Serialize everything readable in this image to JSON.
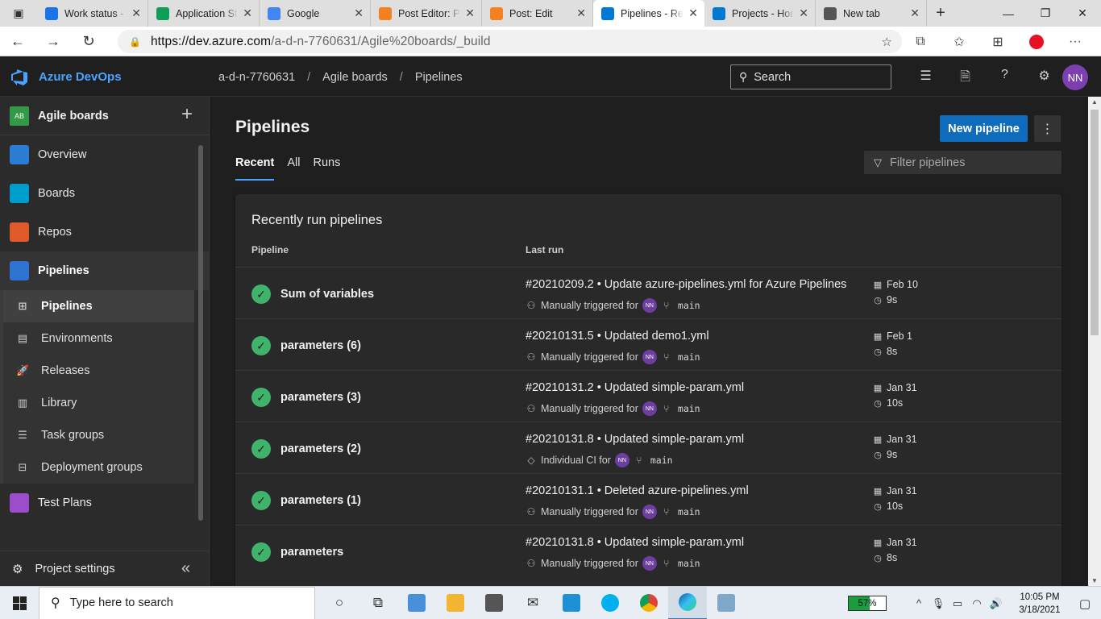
{
  "browser": {
    "tabs": [
      {
        "title": "Work status -",
        "favicon_color": "#1a73e8"
      },
      {
        "title": "Application St",
        "favicon_color": "#0f9d58"
      },
      {
        "title": "Google",
        "favicon_color": "#4285f4"
      },
      {
        "title": "Post Editor: P",
        "favicon_color": "#f48120"
      },
      {
        "title": "Post: Edit",
        "favicon_color": "#f48120"
      },
      {
        "title": "Pipelines - Re",
        "favicon_color": "#0078d4",
        "active": true
      },
      {
        "title": "Projects - Hor",
        "favicon_color": "#0078d4"
      },
      {
        "title": "New tab",
        "favicon_color": "#555555"
      }
    ],
    "url_host": "https://dev.azure.com",
    "url_path": "/a-d-n-7760631/Agile%20boards/_build"
  },
  "ado": {
    "brand": "Azure DevOps",
    "breadcrumb": [
      "a-d-n-7760631",
      "Agile boards",
      "Pipelines"
    ],
    "search_placeholder": "Search",
    "avatar_initials": "NN",
    "accent": "#4aa3ff"
  },
  "sidebar": {
    "project_badge": "AB",
    "project_name": "Agile boards",
    "items": [
      {
        "label": "Overview",
        "color": "#2b7cd3"
      },
      {
        "label": "Boards",
        "color": "#009ccc"
      },
      {
        "label": "Repos",
        "color": "#e05a2b"
      },
      {
        "label": "Pipelines",
        "color": "#2f74d0"
      }
    ],
    "sub_items": [
      {
        "label": "Pipelines",
        "icon": "pipelines-icon",
        "selected": true
      },
      {
        "label": "Environments",
        "icon": "environments-icon"
      },
      {
        "label": "Releases",
        "icon": "releases-icon"
      },
      {
        "label": "Library",
        "icon": "library-icon"
      },
      {
        "label": "Task groups",
        "icon": "task-groups-icon"
      },
      {
        "label": "Deployment groups",
        "icon": "deployment-groups-icon"
      }
    ],
    "test_plans": "Test Plans",
    "project_settings": "Project settings"
  },
  "main": {
    "title": "Pipelines",
    "new_pipeline": "New pipeline",
    "tabs": [
      "Recent",
      "All",
      "Runs"
    ],
    "filter_placeholder": "Filter pipelines",
    "card_title": "Recently run pipelines",
    "col_pipeline": "Pipeline",
    "col_last_run": "Last run",
    "rows": [
      {
        "name": "Sum of variables",
        "run": "#20210209.2 • Update azure-pipelines.yml for Azure Pipelines",
        "trigger": "Manually triggered for",
        "trigger_icon": "person-icon",
        "branch": "main",
        "date": "Feb 10",
        "duration": "9s"
      },
      {
        "name": "parameters (6)",
        "run": "#20210131.5 • Updated demo1.yml",
        "trigger": "Manually triggered for",
        "trigger_icon": "person-icon",
        "branch": "main",
        "date": "Feb 1",
        "duration": "8s"
      },
      {
        "name": "parameters (3)",
        "run": "#20210131.2 • Updated simple-param.yml",
        "trigger": "Manually triggered for",
        "trigger_icon": "person-icon",
        "branch": "main",
        "date": "Jan 31",
        "duration": "10s"
      },
      {
        "name": "parameters (2)",
        "run": "#20210131.8 • Updated simple-param.yml",
        "trigger": "Individual CI for",
        "trigger_icon": "tag-icon",
        "branch": "main",
        "date": "Jan 31",
        "duration": "9s"
      },
      {
        "name": "parameters (1)",
        "run": "#20210131.1 • Deleted azure-pipelines.yml",
        "trigger": "Manually triggered for",
        "trigger_icon": "person-icon",
        "branch": "main",
        "date": "Jan 31",
        "duration": "10s"
      },
      {
        "name": "parameters",
        "run": "#20210131.8 • Updated simple-param.yml",
        "trigger": "Manually triggered for",
        "trigger_icon": "person-icon",
        "branch": "main",
        "date": "Jan 31",
        "duration": "8s"
      }
    ],
    "user_initials": "NN",
    "success_color": "#3fb36b"
  },
  "taskbar": {
    "search_placeholder": "Type here to search",
    "battery": "57%",
    "battery_level": 0.57,
    "time": "10:05 PM",
    "date": "3/18/2021"
  }
}
